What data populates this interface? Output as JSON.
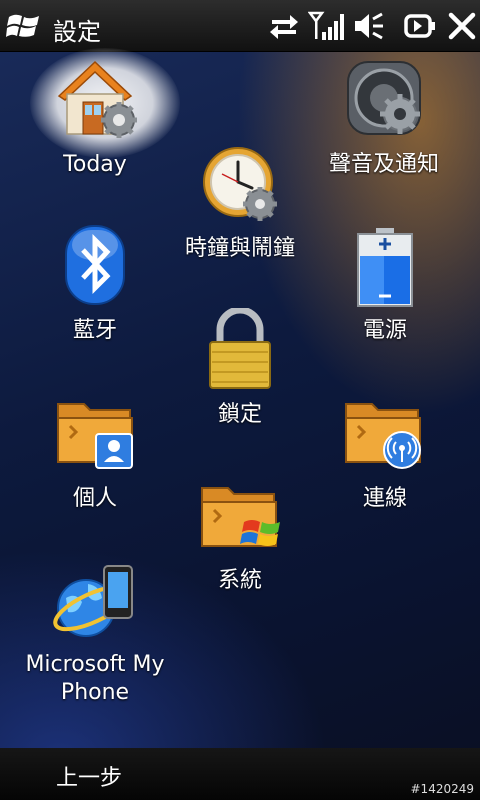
{
  "status_bar": {
    "title": "設定",
    "icons": [
      "windows-start-icon",
      "data-sync-arrows-icon",
      "signal-strength-icon",
      "speaker-mute-icon",
      "power-plug-icon",
      "close-icon"
    ]
  },
  "items": {
    "today": {
      "label": "Today",
      "icon": "house-gear-icon"
    },
    "sound": {
      "label": "聲音及通知",
      "icon": "speaker-gear-icon"
    },
    "clock": {
      "label": "時鐘與鬧鐘",
      "icon": "clock-gear-icon"
    },
    "bluetooth": {
      "label": "藍牙",
      "icon": "bluetooth-icon"
    },
    "power": {
      "label": "電源",
      "icon": "battery-icon"
    },
    "lock": {
      "label": "鎖定",
      "icon": "padlock-icon"
    },
    "personal": {
      "label": "個人",
      "icon": "folder-person-icon"
    },
    "connections": {
      "label": "連線",
      "icon": "folder-wireless-icon"
    },
    "system": {
      "label": "系統",
      "icon": "folder-windows-icon"
    },
    "myphone": {
      "label_line1": "Microsoft My",
      "label_line2": "Phone",
      "icon": "globe-phone-icon"
    }
  },
  "bottom_bar": {
    "softkey_left": "上一步",
    "watermark": "#1420249"
  }
}
